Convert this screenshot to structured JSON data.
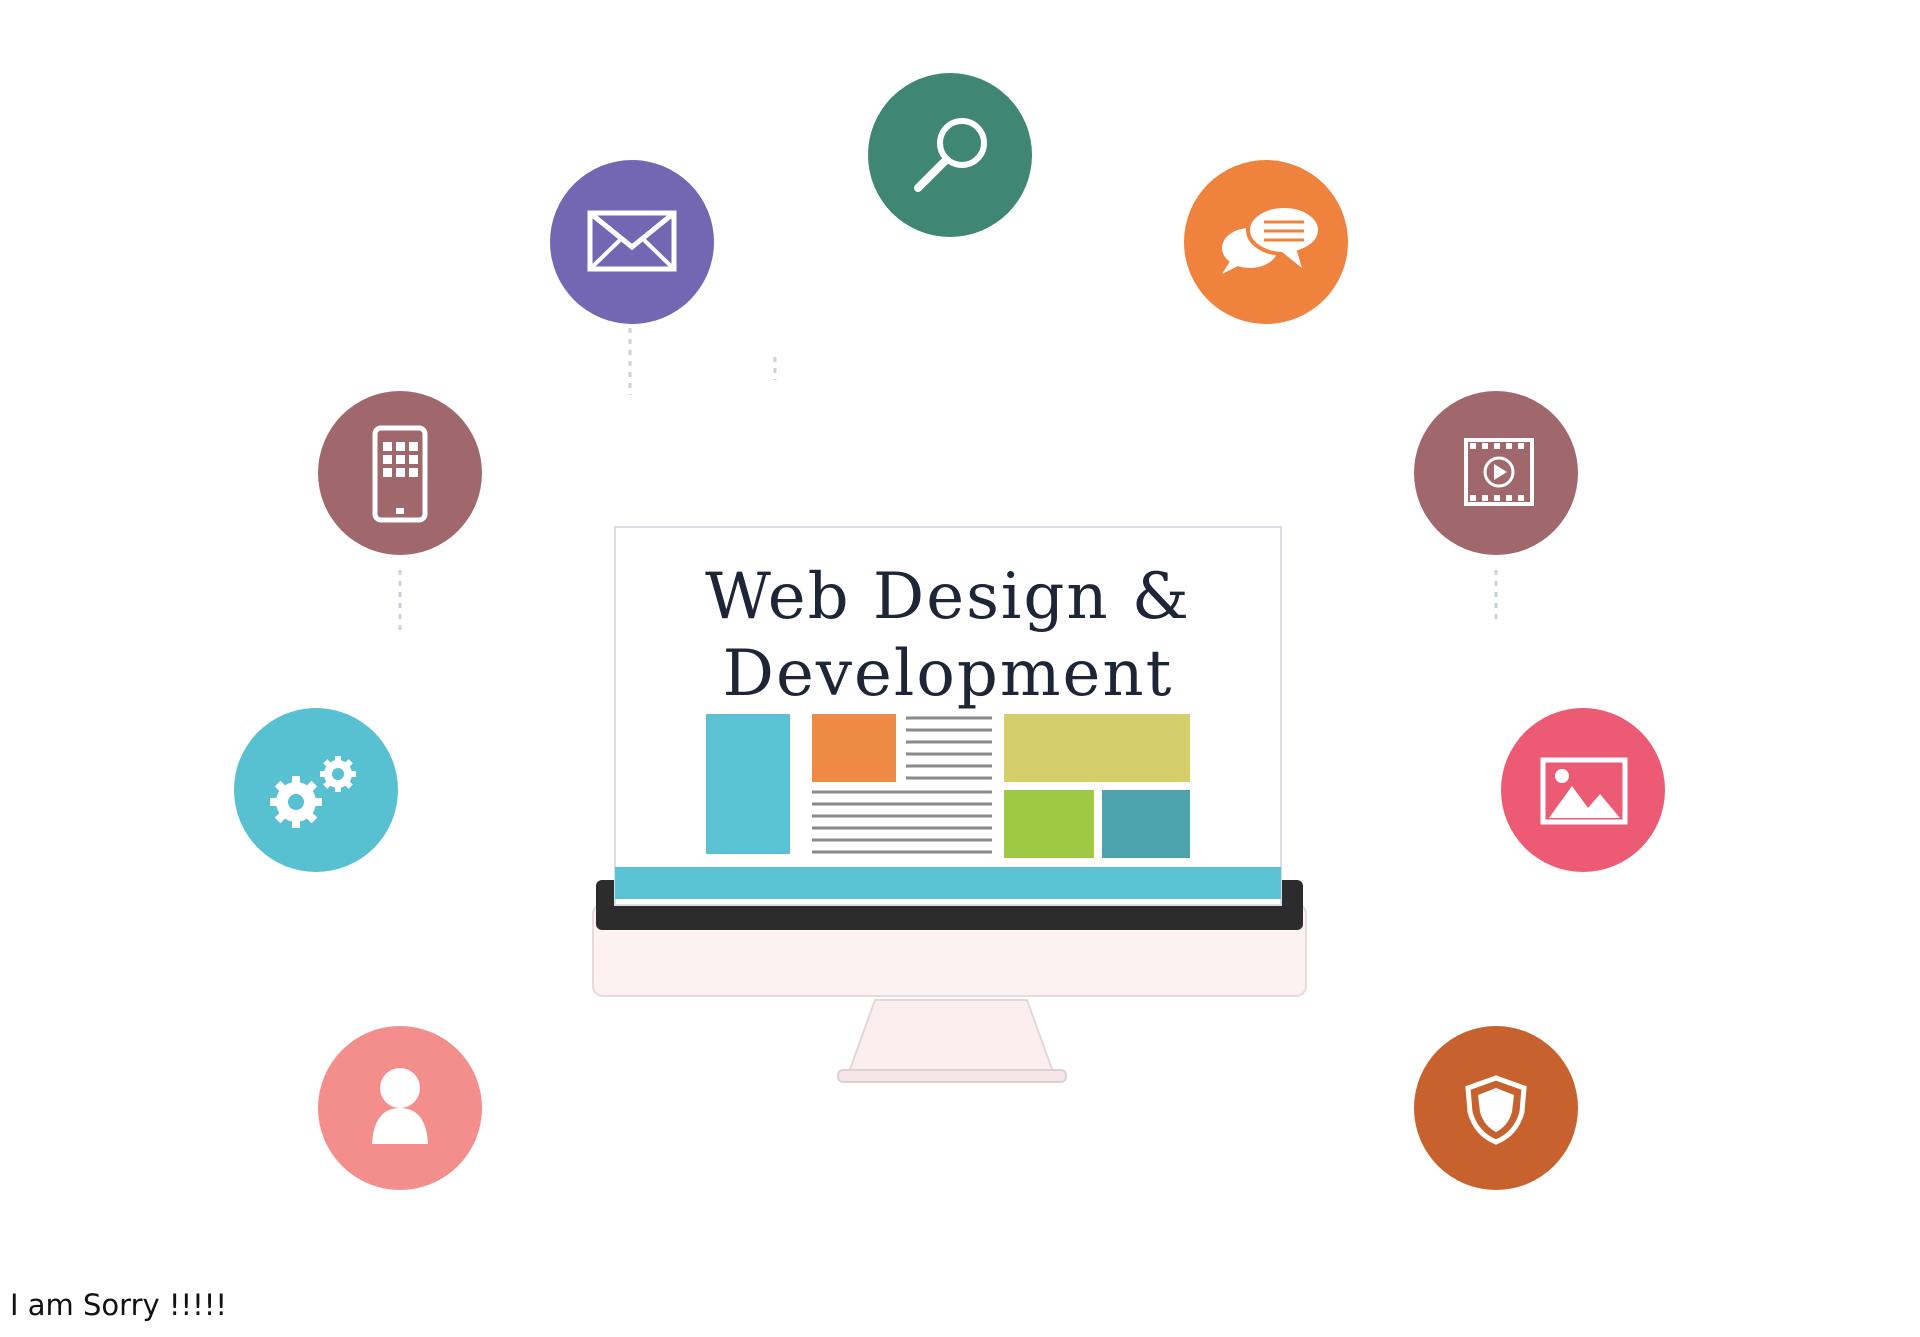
{
  "hero": {
    "title_line1": "Web Design &",
    "title_line2": "Development",
    "icons": [
      {
        "name": "search-icon",
        "color": "#3f8774"
      },
      {
        "name": "mail-icon",
        "color": "#7366b3"
      },
      {
        "name": "chat-icon",
        "color": "#ef823d"
      },
      {
        "name": "mobile-icon",
        "color": "#a0676d"
      },
      {
        "name": "video-icon",
        "color": "#a0676d"
      },
      {
        "name": "gears-icon",
        "color": "#57c0d1"
      },
      {
        "name": "image-icon",
        "color": "#ec5b73"
      },
      {
        "name": "user-icon",
        "color": "#f48e8d"
      },
      {
        "name": "shield-icon",
        "color": "#c7622e"
      }
    ],
    "colors": {
      "screen_stripe": "#5bc2d3",
      "bezel": "#2c2c2c",
      "monitor_body": "#fdf2f3",
      "block_teal": "#5bc2d3",
      "block_orange": "#ef8a45",
      "block_olive": "#d6cd6b",
      "block_green": "#9fc942",
      "block_dark_teal": "#4ea4ac"
    }
  },
  "caption": {
    "text": "I am Sorry !!!!!"
  }
}
